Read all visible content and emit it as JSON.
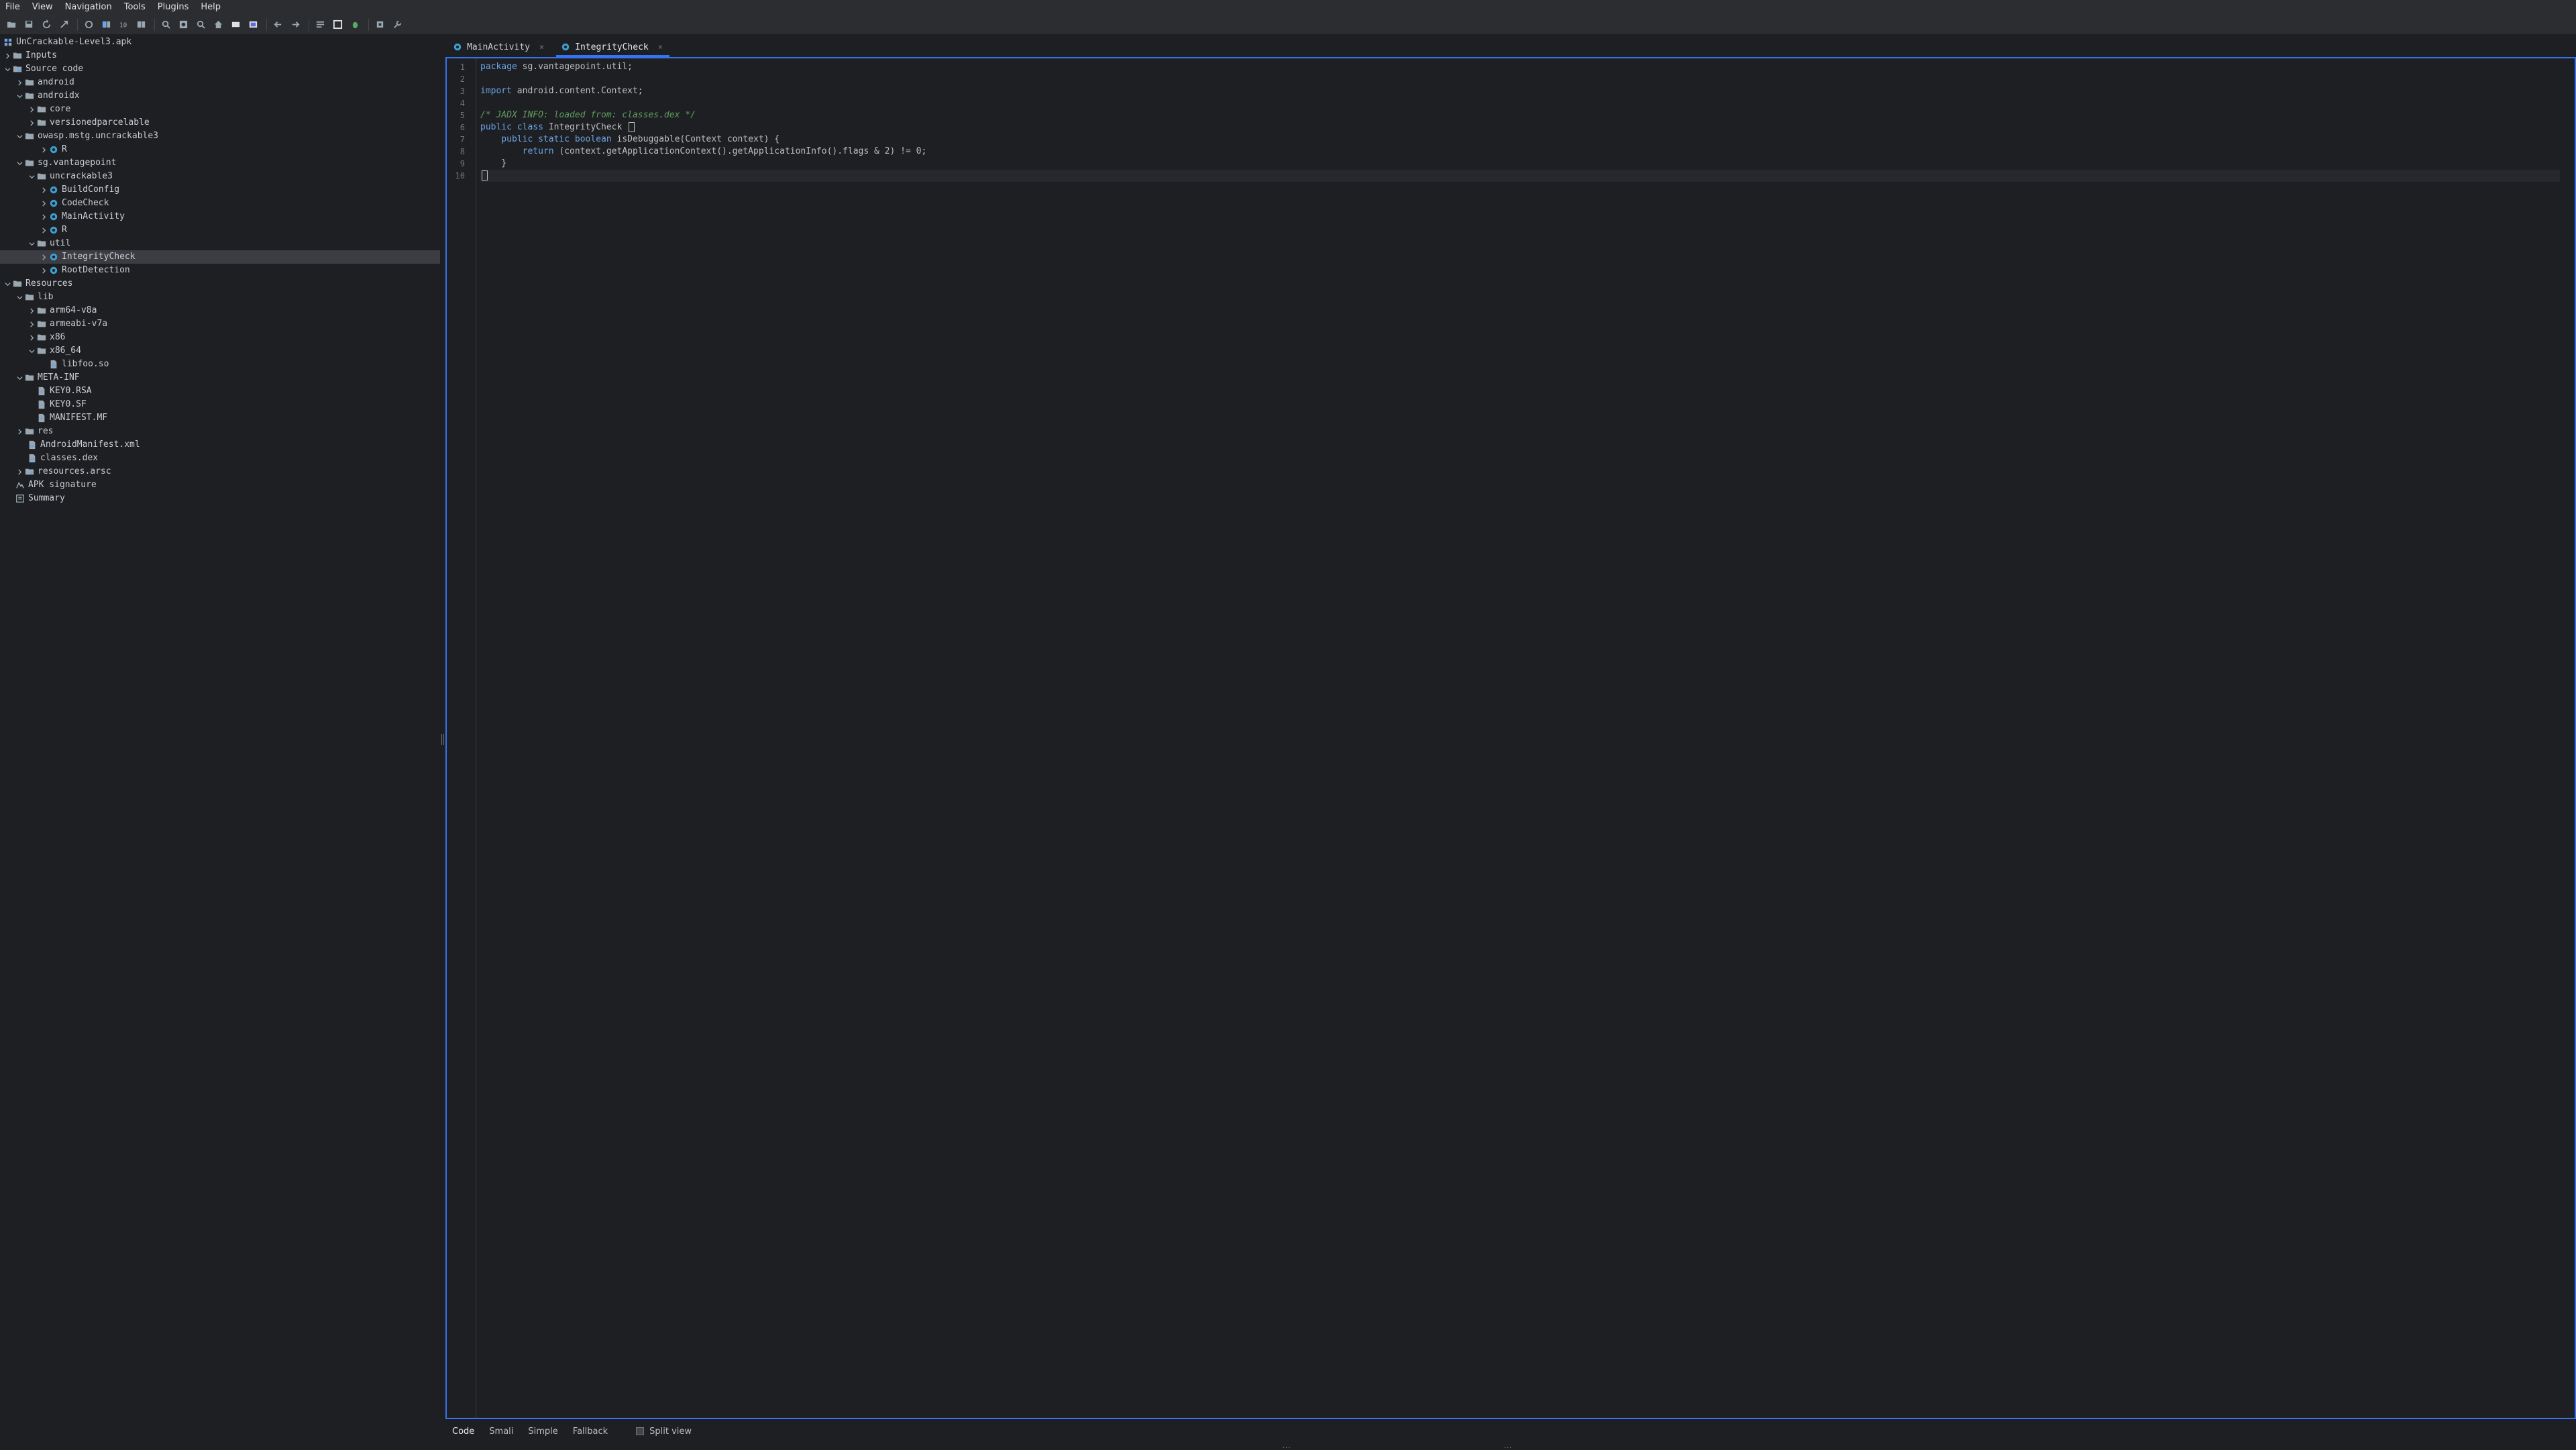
{
  "menu": [
    "File",
    "View",
    "Navigation",
    "Tools",
    "Plugins",
    "Help"
  ],
  "toolbar_icons": [
    "open-file-icon",
    "save-all-icon",
    "refresh-icon",
    "export-icon",
    "sync-icon",
    "decompile-icon",
    "run-icon",
    "split-icon",
    "search-icon",
    "search-class-icon",
    "search-usage-icon",
    "home-icon",
    "box-icon",
    "box-alt-icon",
    "back-icon",
    "forward-icon",
    "log-icon",
    "layout-icon",
    "debug-bug-icon",
    "settings-box-icon",
    "wrench-icon"
  ],
  "tree": {
    "root": "UnCrackable-Level3.apk",
    "inputs": "Inputs",
    "source_code": "Source code",
    "android": "android",
    "androidx": "androidx",
    "core": "core",
    "versionedparcelable": "versionedparcelable",
    "owasp": "owasp.mstg.uncrackable3",
    "owasp_r": "R",
    "sg": "sg.vantagepoint",
    "uncrackable3": "uncrackable3",
    "buildconfig": "BuildConfig",
    "codecheck": "CodeCheck",
    "mainactivity": "MainActivity",
    "uncrackable_r": "R",
    "util": "util",
    "integritycheck": "IntegrityCheck",
    "rootdetection": "RootDetection",
    "resources": "Resources",
    "lib": "lib",
    "arm64": "arm64-v8a",
    "armeabi": "armeabi-v7a",
    "x86": "x86",
    "x86_64": "x86_64",
    "libfoo": "libfoo.so",
    "metainf": "META-INF",
    "keyrsa": "KEY0.RSA",
    "keysf": "KEY0.SF",
    "manifestmf": "MANIFEST.MF",
    "res": "res",
    "androidmanifest": "AndroidManifest.xml",
    "classesdex": "classes.dex",
    "resourcesarsc": "resources.arsc",
    "apksignature": "APK signature",
    "summary": "Summary"
  },
  "tabs": [
    {
      "label": "MainActivity",
      "close": "×"
    },
    {
      "label": "IntegrityCheck",
      "close": "×"
    }
  ],
  "code": {
    "line_numbers": [
      "1",
      "2",
      "3",
      "4",
      "5",
      "6",
      "7",
      "8",
      "9",
      "10"
    ],
    "l1_kw": "package",
    "l1_rest": " sg.vantagepoint.util;",
    "l3_kw": "import",
    "l3_rest": " android.content.Context;",
    "l5_comment": "/* JADX INFO: loaded from: classes.dex */",
    "l6_kw": "public class",
    "l6_rest": " IntegrityCheck ",
    "l7_kw": "    public static boolean",
    "l7_rest": " isDebuggable(Context context) {",
    "l8_kw": "        return",
    "l8_rest": " (context.getApplicationContext().getApplicationInfo().flags & 2) != 0;",
    "l9": "    }"
  },
  "bottom_tabs": [
    "Code",
    "Smali",
    "Simple",
    "Fallback"
  ],
  "split_view": "Split view",
  "dots": "...",
  "colors": {
    "accent": "#3574f0",
    "background": "#1e1f22",
    "panel": "#2b2d30"
  }
}
